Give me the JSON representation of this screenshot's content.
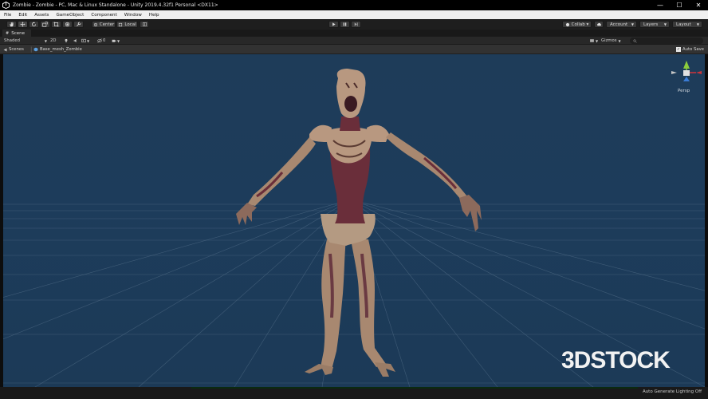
{
  "window": {
    "title": "Zombie - Zombie - PC, Mac & Linux Standalone - Unity 2019.4.32f1 Personal <DX11>",
    "controls": {
      "minimize": "—",
      "maximize": "☐",
      "close": "✕"
    }
  },
  "menu": {
    "items": [
      "File",
      "Edit",
      "Assets",
      "GameObject",
      "Component",
      "Window",
      "Help"
    ]
  },
  "toolbar": {
    "pivot": "Center",
    "space": "Local",
    "collab": "Collab ▾",
    "account": "Account",
    "layers": "Layers",
    "layout": "Layout"
  },
  "tabs": {
    "scene": "Scene"
  },
  "scene_toolbar": {
    "draw_mode": "Shaded",
    "mode_2d": "2D",
    "fx_count": "0",
    "gizmos": "Gizmos",
    "search_placeholder": "All"
  },
  "breadcrumb": {
    "root": "Scenes",
    "item": "Base_mesh_Zombie",
    "auto_save": "Auto Save"
  },
  "viewport": {
    "projection": "Persp",
    "watermark": "3DSTOCK"
  },
  "status": {
    "message": "Auto Generate Lighting Off"
  },
  "colors": {
    "sky": "#1d3c5b",
    "grid": "#5b7690",
    "skin": "#b89880",
    "flesh": "#6a2e3a",
    "gizmo_x": "#d0353b",
    "gizmo_y": "#8bcc3c",
    "gizmo_z": "#3a7bd5"
  }
}
